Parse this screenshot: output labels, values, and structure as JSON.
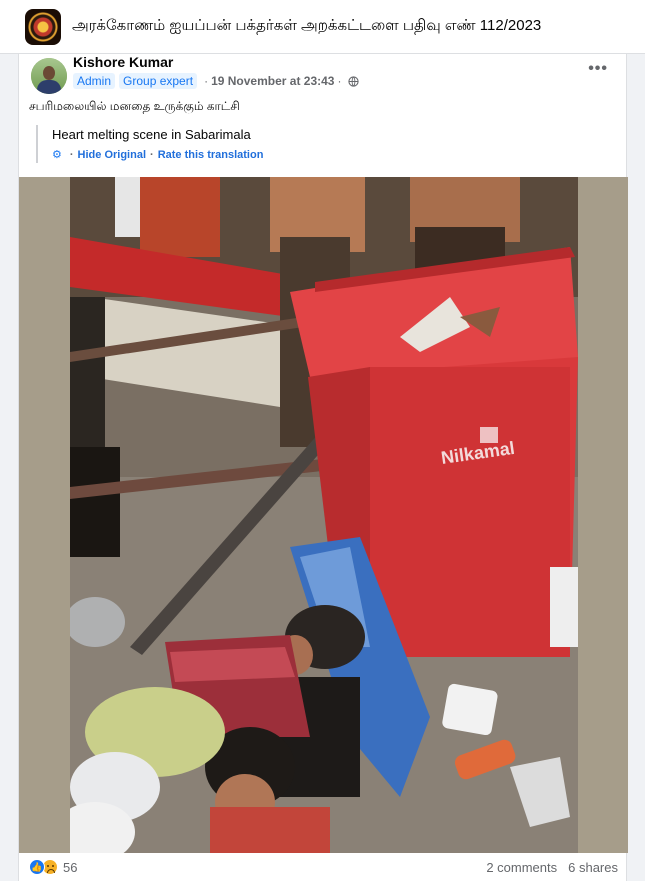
{
  "group": {
    "name": "அரக்கோணம் ஐயப்பன் பக்தர்கள் அறக்கட்டளை பதிவு எண் 112/2023"
  },
  "post": {
    "author": "Kishore Kumar",
    "badges": [
      "Admin",
      "Group expert"
    ],
    "date": "19 November at 23:43",
    "privacy_icon": "globe-icon",
    "more_icon": "more-options-icon",
    "text": "சபரிமலையில் மனதை உருக்கும் காட்சி",
    "translation": {
      "text": "Heart melting scene in Sabarimala",
      "hide_label": "Hide Original",
      "rate_label": "Rate this translation"
    },
    "image_brand_label": "Nilkamal"
  },
  "stats": {
    "reactions": [
      "like-icon",
      "sad-icon"
    ],
    "reaction_count": "56",
    "comments": "2 comments",
    "shares": "6 shares"
  },
  "colors": {
    "accent": "#1877f2",
    "link": "#216fdb",
    "bin_red": "#d9393b"
  }
}
